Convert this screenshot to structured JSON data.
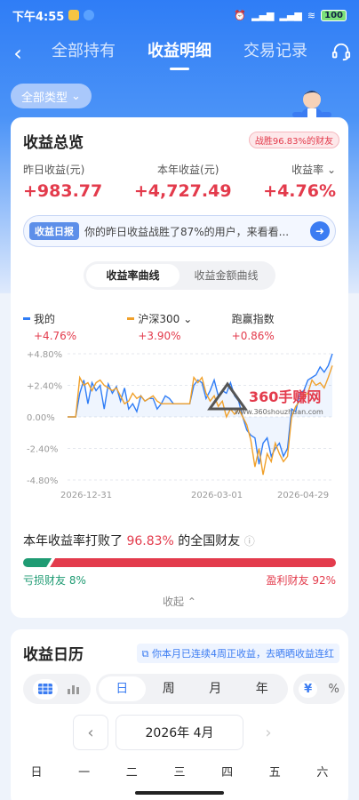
{
  "status_bar": {
    "time": "下午4:55",
    "battery": "100"
  },
  "nav": {
    "tabs": [
      {
        "label": "全部持有"
      },
      {
        "label": "收益明细"
      },
      {
        "label": "交易记录"
      }
    ]
  },
  "filter": {
    "label": "全部类型"
  },
  "summary": {
    "title": "收益总览",
    "rank_badge": "战胜96.83%的财友",
    "stats": [
      {
        "label": "昨日收益(元)",
        "value": "+983.77"
      },
      {
        "label": "本年收益(元)",
        "value": "+4,727.49"
      },
      {
        "label": "收益率",
        "value": "+4.76%"
      }
    ],
    "daily_report": {
      "tag": "收益日报",
      "text": "你的昨日收益战胜了87%的用户，来看看..."
    },
    "curve_tabs": [
      "收益率曲线",
      "收益金额曲线"
    ],
    "legend": [
      {
        "name": "我的",
        "value": "+4.76%",
        "color": "#2f7df6"
      },
      {
        "name": "沪深300",
        "value": "+3.90%",
        "color": "#f0a02a"
      },
      {
        "name": "跑赢指数",
        "value": "+0.86%",
        "color": "#e33b4c"
      }
    ],
    "beat_text_prefix": "本年收益率打败了",
    "beat_pct": "96.83%",
    "beat_text_suffix": "的全国财友",
    "loss_label": "亏损财友 8%",
    "gain_label": "盈利财友 92%",
    "loss_share": 0.08,
    "collapse_label": "收起"
  },
  "chart_data": {
    "type": "line",
    "y_ticks": [
      "+4.80%",
      "+2.40%",
      "0.00%",
      "-2.40%",
      "-4.80%"
    ],
    "ylim": [
      -4.8,
      4.8
    ],
    "x_ticks": [
      "2026-12-31",
      "2026-03-01",
      "2026-04-29"
    ],
    "series": [
      {
        "name": "我的",
        "color": "#2f7df6",
        "values": [
          0.0,
          0.0,
          0.0,
          1.8,
          2.8,
          1.0,
          2.6,
          2.0,
          2.4,
          0.6,
          2.5,
          1.8,
          2.3,
          1.2,
          2.2,
          0.6,
          1.0,
          0.4,
          1.6,
          1.2,
          1.4,
          1.4,
          0.6,
          1.0,
          1.6,
          1.4,
          1.0,
          1.0,
          1.0,
          1.0,
          1.0,
          2.4,
          2.8,
          2.6,
          1.4,
          2.0,
          2.8,
          1.6,
          2.0,
          1.8,
          2.6,
          1.6,
          1.2,
          0.0,
          -1.0,
          -1.4,
          -1.6,
          -3.6,
          -2.0,
          -1.6,
          -3.0,
          -2.4,
          -2.0,
          -3.0,
          -2.4,
          0.6,
          0.4,
          1.8,
          2.0,
          2.8,
          3.0,
          3.2,
          3.8,
          3.4,
          3.9,
          4.8
        ]
      },
      {
        "name": "沪深300",
        "color": "#f0a02a",
        "values": [
          0.0,
          0.0,
          0.0,
          3.0,
          2.4,
          2.6,
          2.0,
          2.6,
          2.8,
          2.4,
          2.2,
          2.0,
          2.2,
          1.6,
          1.0,
          1.2,
          1.8,
          1.4,
          1.6,
          1.2,
          1.4,
          1.6,
          1.2,
          1.0,
          1.0,
          1.0,
          1.0,
          1.0,
          1.0,
          1.0,
          1.0,
          3.0,
          2.6,
          3.0,
          1.8,
          1.2,
          1.6,
          0.8,
          1.2,
          0.0,
          0.6,
          0.2,
          0.6,
          0.0,
          -0.6,
          -1.8,
          -3.8,
          -2.4,
          -4.4,
          -2.8,
          -3.4,
          -2.0,
          -2.8,
          -3.4,
          -3.0,
          0.0,
          0.8,
          1.2,
          1.6,
          1.8,
          2.8,
          2.4,
          2.6,
          2.2,
          3.0,
          3.9
        ]
      }
    ],
    "grid": true,
    "legend": "top"
  },
  "calendar": {
    "title": "收益日历",
    "hint": "你本月已连续4周正收益，去晒晒收益连红",
    "period_tabs": [
      "日",
      "周",
      "月",
      "年"
    ],
    "units": [
      "¥",
      "%"
    ],
    "month_label": "2026年 4月",
    "weekdays": [
      "日",
      "一",
      "二",
      "三",
      "四",
      "五",
      "六"
    ]
  },
  "watermark": {
    "title": "360手赚网",
    "url": "www.360shouzhuan.com"
  }
}
